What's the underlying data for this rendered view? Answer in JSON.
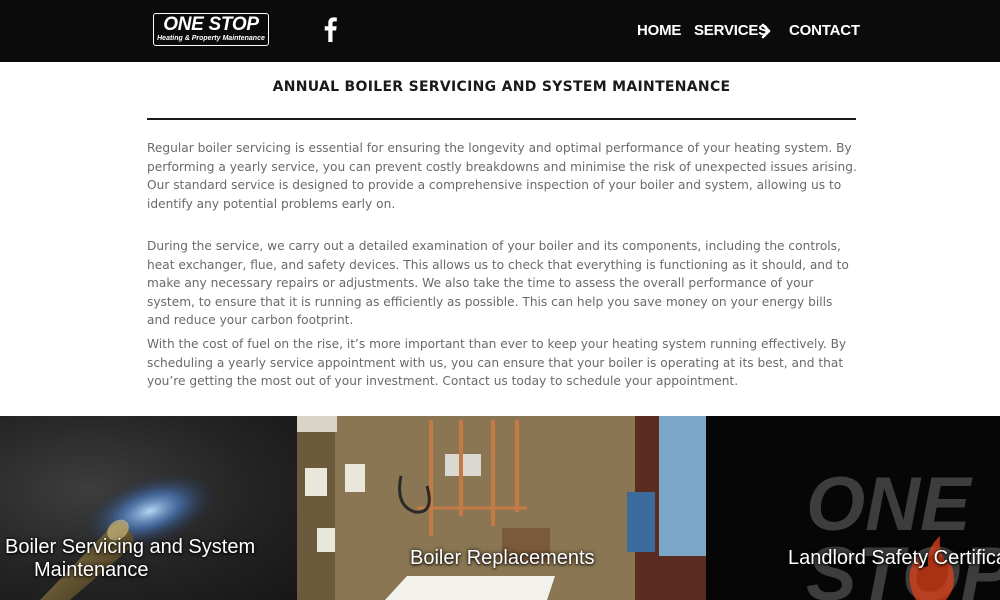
{
  "header": {
    "logo": {
      "main": "ONE STOP",
      "sub": "Heating & Property Maintenance"
    },
    "social_icon": "facebook-icon",
    "nav": {
      "home": "HOME",
      "services": "SERVICES",
      "services_icon": "chevron-right-icon",
      "contact": "CONTACT"
    }
  },
  "main": {
    "title": "ANNUAL BOILER SERVICING AND SYSTEM MAINTENANCE",
    "paragraphs": [
      "Regular boiler servicing is essential for ensuring the longevity and optimal performance of your heating system. By performing a yearly service, you can prevent costly breakdowns and minimise the risk of unexpected issues arising. Our standard service is designed to provide a comprehensive inspection of your boiler and system, allowing us to identify any potential problems early on.",
      "During the service, we carry out a detailed examination of your boiler and its components, including the controls, heat exchanger, flue, and safety devices. This allows us to check that everything is functioning as it should, and to make any necessary repairs or adjustments. We also take the time to assess the overall performance of your system, to ensure that it is running as efficiently as possible. This can help you save money on your energy bills and reduce your carbon footprint.",
      "With the cost of fuel on the rise, it’s more important than ever to keep your heating system running effectively. By scheduling a yearly service appointment with us, you can ensure that your boiler is operating at its best, and that you’re getting the most out of your investment. Contact us today to schedule your appointment."
    ]
  },
  "tiles": [
    {
      "label_line1": "Boiler Servicing and System",
      "label_line2": "Maintenance"
    },
    {
      "label": "Boiler Replacements"
    },
    {
      "label": "Landlord Safety Certifica",
      "watermark_line1": "ONE",
      "watermark_line2": "STOP"
    }
  ],
  "colors": {
    "header_bg": "#0b0b0b",
    "body_text": "#6a6a6a",
    "heading_text": "#1a1a1a",
    "flame_accent": "#e0401a"
  }
}
